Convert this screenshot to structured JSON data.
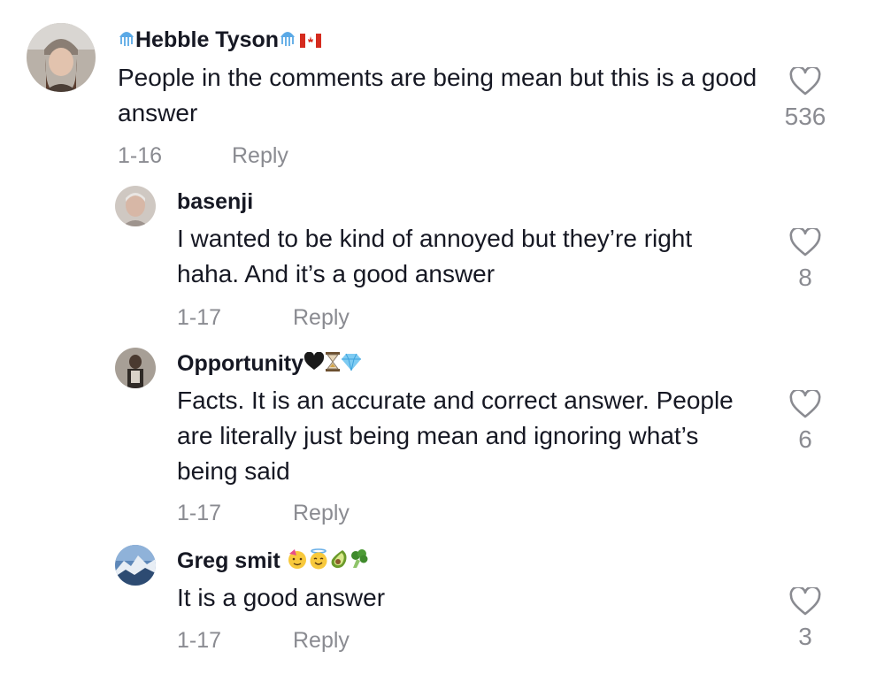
{
  "comments": [
    {
      "username": "Hebble Tyson",
      "text": "People in the comments are being mean but this is a good answer",
      "date": "1-16",
      "reply_label": "Reply",
      "likes": "536"
    },
    {
      "username": "basenji",
      "text": "I wanted to be kind of annoyed but they’re right haha. And it’s a good answer",
      "date": "1-17",
      "reply_label": "Reply",
      "likes": "8"
    },
    {
      "username": "Opportunity",
      "text": "Facts. It is an accurate and correct answer. People are literally just being mean and ignoring what’s being said",
      "date": "1-17",
      "reply_label": "Reply",
      "likes": "6"
    },
    {
      "username": "Greg smit",
      "text": "It is a good answer",
      "date": "1-17",
      "reply_label": "Reply",
      "likes": "3"
    }
  ],
  "icons": {
    "like": "heart-outline-icon",
    "name_decor_1": [
      "jellyfish-icon",
      "jellyfish-icon",
      "canada-flag-icon"
    ],
    "name_decor_3": [
      "black-heart-icon",
      "hourglass-icon",
      "diamond-icon"
    ],
    "name_decor_4": [
      "partying-face-icon",
      "smiling-face-halo-icon",
      "avocado-icon",
      "broccoli-icon"
    ]
  },
  "colors": {
    "text_primary": "#161823",
    "text_secondary": "#8a8b91",
    "background": "#ffffff"
  }
}
